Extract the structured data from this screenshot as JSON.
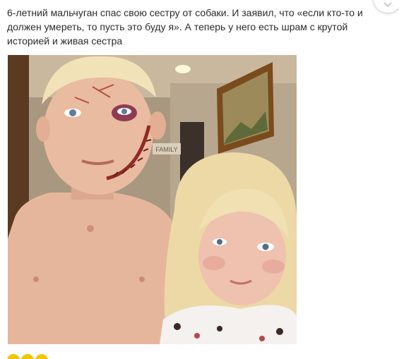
{
  "post": {
    "text": "6-летний мальчуган спас свою сестру от собаки. И заявил, что «если кто-то и должен умереть, то пусть это буду я». А теперь у него есть шрам с крутой историей и живая сестра"
  },
  "photo": {
    "sign_text": "FAMILY"
  },
  "icons": {
    "corner": "chevron-icon",
    "reactions": "reaction-icon"
  },
  "colors": {
    "text": "#2b2b2b",
    "reaction": "#f5c400"
  }
}
